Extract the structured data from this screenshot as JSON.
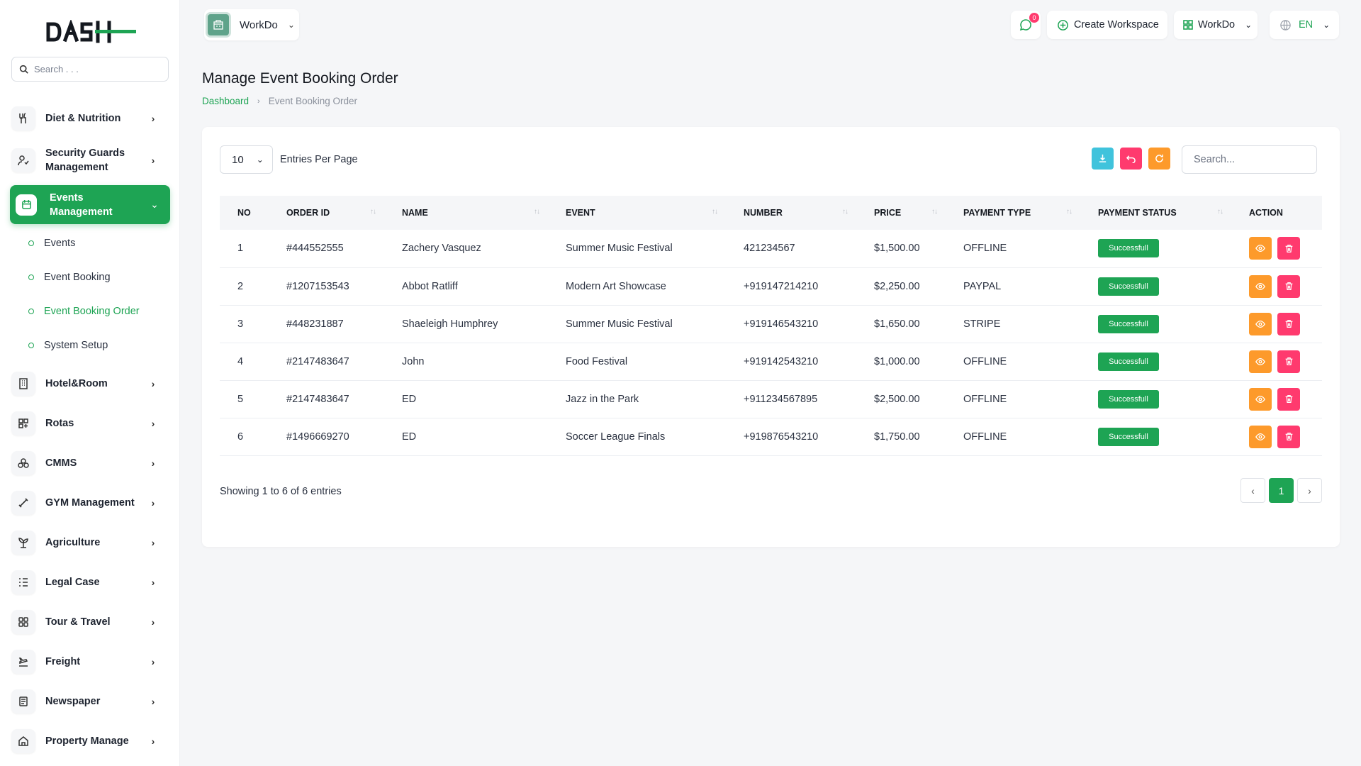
{
  "brand": {
    "logo_text": "DASH"
  },
  "sidebar": {
    "search_placeholder": "Search . . .",
    "items_top": [
      {
        "label": "Diet & Nutrition",
        "icon": "utensils-icon"
      },
      {
        "label": "Security Guards Management",
        "icon": "user-shield-icon"
      }
    ],
    "active": {
      "label": "Events Management",
      "icon": "calendar-icon"
    },
    "sub_items": [
      {
        "label": "Events"
      },
      {
        "label": "Event Booking"
      },
      {
        "label": "Event Booking Order"
      },
      {
        "label": "System Setup"
      }
    ],
    "items_bottom": [
      {
        "label": "Hotel&Room",
        "icon": "building-icon"
      },
      {
        "label": "Rotas",
        "icon": "grid-icon"
      },
      {
        "label": "CMMS",
        "icon": "cogs-icon"
      },
      {
        "label": "GYM Management",
        "icon": "dumbbell-icon"
      },
      {
        "label": "Agriculture",
        "icon": "plant-icon"
      },
      {
        "label": "Legal Case",
        "icon": "list-icon"
      },
      {
        "label": "Tour & Travel",
        "icon": "apps-icon"
      },
      {
        "label": "Freight",
        "icon": "plane-icon"
      },
      {
        "label": "Newspaper",
        "icon": "newspaper-icon"
      },
      {
        "label": "Property Manage",
        "icon": "home-icon"
      }
    ]
  },
  "topbar": {
    "workspace": "WorkDo",
    "notification_count": "0",
    "create_workspace": "Create Workspace",
    "workspace_switch": "WorkDo",
    "language": "EN"
  },
  "page": {
    "title": "Manage Event Booking Order",
    "breadcrumb_home": "Dashboard",
    "breadcrumb_current": "Event Booking Order"
  },
  "table": {
    "per_page": "10",
    "per_page_label": "Entries Per Page",
    "search_placeholder": "Search...",
    "columns": [
      "NO",
      "ORDER ID",
      "NAME",
      "EVENT",
      "NUMBER",
      "PRICE",
      "PAYMENT TYPE",
      "PAYMENT STATUS",
      "ACTION"
    ],
    "rows": [
      [
        "1",
        "#444552555",
        "Zachery Vasquez",
        "Summer Music Festival",
        "421234567",
        "$1,500.00",
        "OFFLINE",
        "Successfull"
      ],
      [
        "2",
        "#1207153543",
        "Abbot Ratliff",
        "Modern Art Showcase",
        "+919147214210",
        "$2,250.00",
        "PAYPAL",
        "Successfull"
      ],
      [
        "3",
        "#448231887",
        "Shaeleigh Humphrey",
        "Summer Music Festival",
        "+919146543210",
        "$1,650.00",
        "STRIPE",
        "Successfull"
      ],
      [
        "4",
        "#2147483647",
        "John",
        "Food Festival",
        "+919142543210",
        "$1,000.00",
        "OFFLINE",
        "Successfull"
      ],
      [
        "5",
        "#2147483647",
        "ED",
        "Jazz in the Park",
        "+911234567895",
        "$2,500.00",
        "OFFLINE",
        "Successfull"
      ],
      [
        "6",
        "#1496669270",
        "ED",
        "Soccer League Finals",
        "+919876543210",
        "$1,750.00",
        "OFFLINE",
        "Successfull"
      ]
    ],
    "showing": "Showing 1 to 6 of 6 entries",
    "current_page": "1"
  },
  "colors": {
    "primary": "#1ea454",
    "info": "#40c3dc",
    "danger": "#ff3a6e",
    "warning": "#fd9a2b"
  }
}
